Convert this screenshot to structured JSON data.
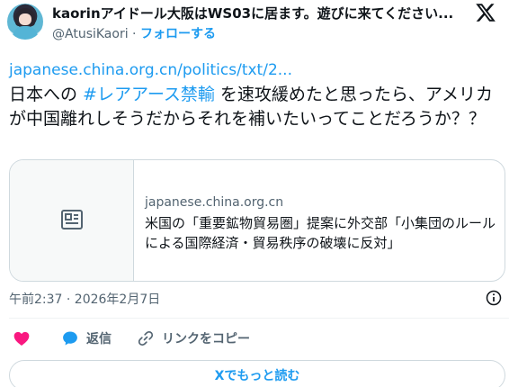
{
  "author": {
    "display_name": "kaorinアイドール大阪はWS03に居ます。遊びに来てください...",
    "handle": "@AtusiKaori",
    "separator": " · ",
    "follow_label": "フォローする",
    "avatar_icon": "profile-avatar"
  },
  "platform": {
    "logo_icon": "x-logo-icon"
  },
  "tweet": {
    "link": "japanese.china.org.cn/politics/txt/2...",
    "text_before": "日本への ",
    "hashtag": "#レアアース禁輸",
    "text_after": " を速攻緩めたと思ったら、アメリカが中国離れしそうだからそれを補いたいってことだろうか？？"
  },
  "card": {
    "domain": "japanese.china.org.cn",
    "title": "米国の「重要鉱物貿易圏」提案に外交部「小集団のルールによる国際経済・貿易秩序の破壊に反対」",
    "thumbnail_icon": "article-icon"
  },
  "meta": {
    "timestamp": "午前2:37 · 2026年2月7日",
    "info_icon": "info-icon"
  },
  "actions": {
    "like_icon": "heart-icon",
    "reply_label": "返信",
    "copy_link_label": "リンクをコピー"
  },
  "read_more_label": "Xでもっと読む",
  "colors": {
    "accent": "#1d9bf0",
    "like": "#f91880",
    "text": "#0f1419",
    "muted": "#536471",
    "border": "#cfd9de"
  }
}
